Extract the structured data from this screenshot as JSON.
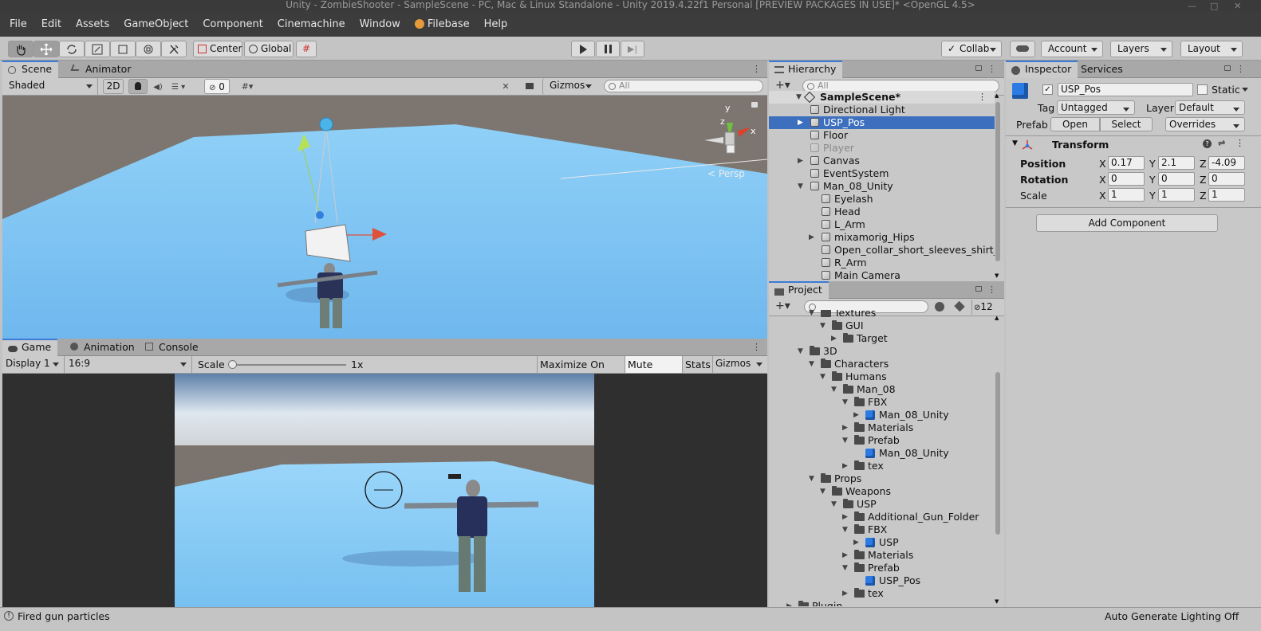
{
  "window": {
    "title": "Unity - ZombieShooter - SampleScene - PC, Mac & Linux Standalone - Unity 2019.4.22f1 Personal [PREVIEW PACKAGES IN USE]* <OpenGL 4.5>"
  },
  "menu": [
    "File",
    "Edit",
    "Assets",
    "GameObject",
    "Component",
    "Cinemachine",
    "Window",
    "Filebase",
    "Help"
  ],
  "toolbar": {
    "pivot": "Center",
    "space": "Global",
    "collab": "Collab",
    "account": "Account",
    "layers": "Layers",
    "layout": "Layout"
  },
  "scene": {
    "tabs": [
      "Scene",
      "Animator"
    ],
    "shading": "Shaded",
    "mode_2d": "2D",
    "hidden_count": "0",
    "gizmos": "Gizmos",
    "search_placeholder": "All",
    "persp_label": "Persp",
    "axis_x": "x",
    "axis_y": "y",
    "axis_z": "z"
  },
  "game": {
    "tabs": [
      "Game",
      "Animation",
      "Console"
    ],
    "display": "Display 1",
    "aspect": "16:9",
    "scale_label": "Scale",
    "scale_value": "1x",
    "maximize": "Maximize On Play",
    "mute": "Mute Audio",
    "stats": "Stats",
    "gizmos": "Gizmos"
  },
  "hierarchy": {
    "tab": "Hierarchy",
    "search_placeholder": "All",
    "scene": "SampleScene*",
    "items": [
      {
        "label": "Directional Light",
        "depth": 1,
        "arrow": "",
        "selected": false,
        "dim": false
      },
      {
        "label": "USP_Pos",
        "depth": 1,
        "arrow": "▶",
        "selected": true,
        "dim": false
      },
      {
        "label": "Floor",
        "depth": 1,
        "arrow": "",
        "selected": false,
        "dim": false
      },
      {
        "label": "Player",
        "depth": 1,
        "arrow": "",
        "selected": false,
        "dim": true
      },
      {
        "label": "Canvas",
        "depth": 1,
        "arrow": "▶",
        "selected": false,
        "dim": false
      },
      {
        "label": "EventSystem",
        "depth": 1,
        "arrow": "",
        "selected": false,
        "dim": false
      },
      {
        "label": "Man_08_Unity",
        "depth": 1,
        "arrow": "▼",
        "selected": false,
        "dim": false
      },
      {
        "label": "Eyelash",
        "depth": 2,
        "arrow": "",
        "selected": false,
        "dim": false
      },
      {
        "label": "Head",
        "depth": 2,
        "arrow": "",
        "selected": false,
        "dim": false
      },
      {
        "label": "L_Arm",
        "depth": 2,
        "arrow": "",
        "selected": false,
        "dim": false
      },
      {
        "label": "mixamorig_Hips",
        "depth": 2,
        "arrow": "▶",
        "selected": false,
        "dim": false
      },
      {
        "label": "Open_collar_short_sleeves_shirt_M",
        "depth": 2,
        "arrow": "",
        "selected": false,
        "dim": false
      },
      {
        "label": "R_Arm",
        "depth": 2,
        "arrow": "",
        "selected": false,
        "dim": false
      },
      {
        "label": "Main Camera",
        "depth": 2,
        "arrow": "",
        "selected": false,
        "dim": false
      }
    ]
  },
  "project": {
    "tab": "Project",
    "hidden_count": "12",
    "items": [
      {
        "label": "Textures",
        "depth": 2,
        "arrow": "▼",
        "icon": "folder"
      },
      {
        "label": "GUI",
        "depth": 3,
        "arrow": "▼",
        "icon": "folder"
      },
      {
        "label": "Target",
        "depth": 4,
        "arrow": "▶",
        "icon": "folder"
      },
      {
        "label": "3D",
        "depth": 1,
        "arrow": "▼",
        "icon": "folder"
      },
      {
        "label": "Characters",
        "depth": 2,
        "arrow": "▼",
        "icon": "folder"
      },
      {
        "label": "Humans",
        "depth": 3,
        "arrow": "▼",
        "icon": "folder"
      },
      {
        "label": "Man_08",
        "depth": 4,
        "arrow": "▼",
        "icon": "folder"
      },
      {
        "label": "FBX",
        "depth": 5,
        "arrow": "▼",
        "icon": "folder"
      },
      {
        "label": "Man_08_Unity",
        "depth": 6,
        "arrow": "▶",
        "icon": "prefab"
      },
      {
        "label": "Materials",
        "depth": 5,
        "arrow": "▶",
        "icon": "folder"
      },
      {
        "label": "Prefab",
        "depth": 5,
        "arrow": "▼",
        "icon": "folder"
      },
      {
        "label": "Man_08_Unity",
        "depth": 6,
        "arrow": "",
        "icon": "prefab"
      },
      {
        "label": "tex",
        "depth": 5,
        "arrow": "▶",
        "icon": "folder"
      },
      {
        "label": "Props",
        "depth": 2,
        "arrow": "▼",
        "icon": "folder"
      },
      {
        "label": "Weapons",
        "depth": 3,
        "arrow": "▼",
        "icon": "folder"
      },
      {
        "label": "USP",
        "depth": 4,
        "arrow": "▼",
        "icon": "folder"
      },
      {
        "label": "Additional_Gun_Folder",
        "depth": 5,
        "arrow": "▶",
        "icon": "folder"
      },
      {
        "label": "FBX",
        "depth": 5,
        "arrow": "▼",
        "icon": "folder"
      },
      {
        "label": "USP",
        "depth": 6,
        "arrow": "▶",
        "icon": "prefab"
      },
      {
        "label": "Materials",
        "depth": 5,
        "arrow": "▶",
        "icon": "folder"
      },
      {
        "label": "Prefab",
        "depth": 5,
        "arrow": "▼",
        "icon": "folder"
      },
      {
        "label": "USP_Pos",
        "depth": 6,
        "arrow": "",
        "icon": "prefab"
      },
      {
        "label": "tex",
        "depth": 5,
        "arrow": "▶",
        "icon": "folder"
      },
      {
        "label": "Plugin",
        "depth": 0,
        "arrow": "▶",
        "icon": "folder"
      }
    ]
  },
  "inspector": {
    "tabs": [
      "Inspector",
      "Services"
    ],
    "object_name": "USP_Pos",
    "static_label": "Static",
    "tag_label": "Tag",
    "tag_value": "Untagged",
    "layer_label": "Layer",
    "layer_value": "Default",
    "prefab_label": "Prefab",
    "open": "Open",
    "select": "Select",
    "overrides": "Overrides",
    "transform_title": "Transform",
    "position_label": "Position",
    "rotation_label": "Rotation",
    "scale_label": "Scale",
    "axis_x": "X",
    "axis_y": "Y",
    "axis_z": "Z",
    "position": [
      "0.17",
      "2.1",
      "-4.09"
    ],
    "rotation": [
      "0",
      "0",
      "0"
    ],
    "scale": [
      "1",
      "1",
      "1"
    ],
    "add_component": "Add Component"
  },
  "status": {
    "message": "Fired gun particles",
    "right": "Auto Generate Lighting Off"
  }
}
